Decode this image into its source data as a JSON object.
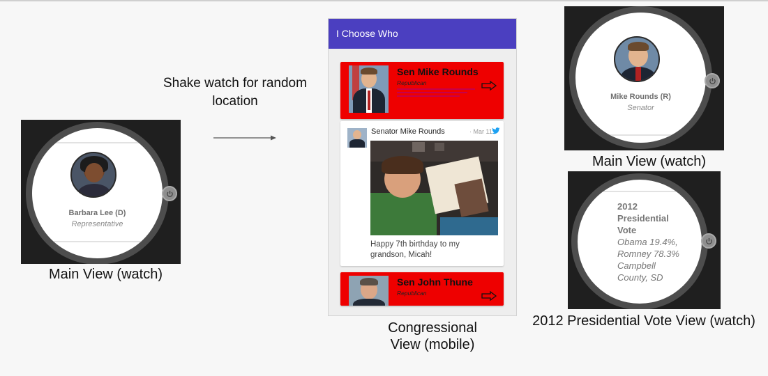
{
  "watch_left": {
    "name": "Barbara Lee (D)",
    "role": "Representative",
    "caption": "Main View (watch)",
    "crown_icon": "power-icon"
  },
  "tip": {
    "line1": "Shake watch for random",
    "line2": "location"
  },
  "phone": {
    "app_title": "I Choose Who",
    "cards": [
      {
        "name": "Sen Mike Rounds",
        "party": "Republican"
      },
      {
        "name": "Sen John Thune",
        "party": "Republican"
      }
    ],
    "tweet": {
      "author": "Senator Mike Rounds",
      "date": "· Mar 11",
      "text": "Happy 7th birthday to my grandson, Micah!"
    },
    "caption_line1": "Congressional",
    "caption_line2": "View (mobile)"
  },
  "watch_top_right": {
    "name": "Mike Rounds (R)",
    "role": "Senator",
    "caption": "Main View (watch)"
  },
  "watch_bottom_right": {
    "title_lines": [
      "2012",
      "Presidential",
      "Vote"
    ],
    "result_lines": [
      "Obama 19.4%,",
      "Romney 78.3%"
    ],
    "location_lines": [
      "Campbell",
      "County, SD"
    ],
    "caption": "2012 Presidential Vote View (watch)"
  },
  "colors": {
    "app_bar": "#4b3fc0",
    "card_red": "#ee0000",
    "watch_bg": "#1f1f1f",
    "bezel": "#4d4d4d",
    "twitter_blue": "#1da1f2"
  }
}
